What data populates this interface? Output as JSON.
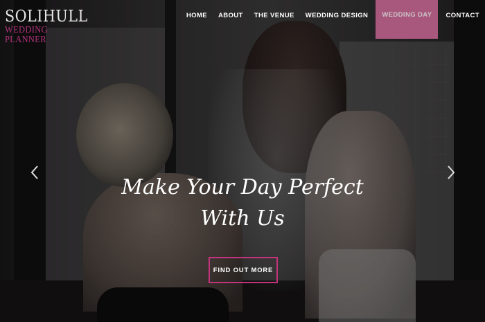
{
  "logo": {
    "main": "SOLIHULL",
    "sub": "WEDDING PLANNER"
  },
  "nav": {
    "items": [
      {
        "label": "HOME"
      },
      {
        "label": "ABOUT"
      },
      {
        "label": "THE VENUE"
      },
      {
        "label": "WEDDING DESIGN"
      },
      {
        "label": "WEDDING DAY",
        "active": true
      },
      {
        "label": "CONTACT"
      }
    ]
  },
  "hero": {
    "headline_line1": "Make Your Day Perfect",
    "headline_line2": "With Us",
    "cta_label": "FIND OUT MORE",
    "prev_icon": "chevron-left-icon",
    "next_icon": "chevron-right-icon"
  },
  "colors": {
    "accent": "#c4337e",
    "active_nav_bg": "#a8587c",
    "logo_sub": "#b0337a"
  }
}
